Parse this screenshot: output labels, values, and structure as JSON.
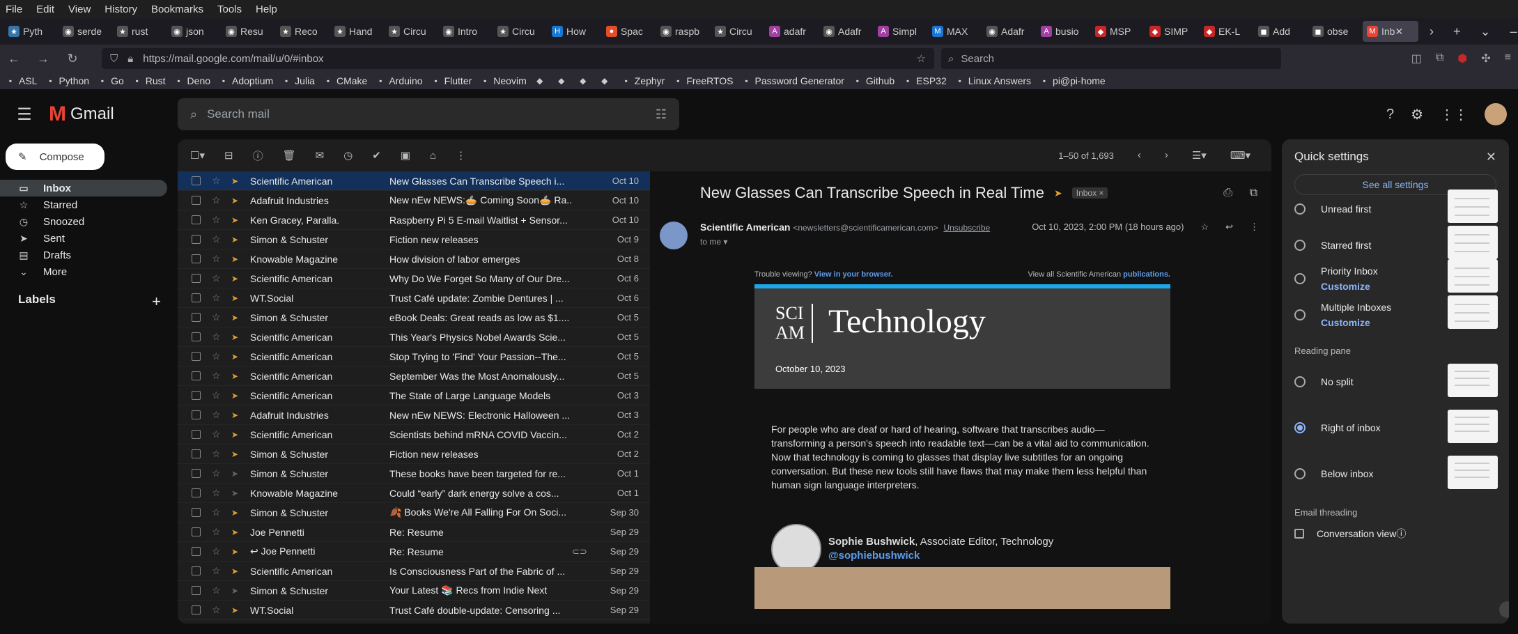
{
  "menubar": [
    "File",
    "Edit",
    "View",
    "History",
    "Bookmarks",
    "Tools",
    "Help"
  ],
  "tabs": [
    {
      "label": "Pyth",
      "color": "#3776ab",
      "glyph": "★"
    },
    {
      "label": "serde",
      "color": "#555",
      "glyph": "◉"
    },
    {
      "label": "rust",
      "color": "#555",
      "glyph": "★"
    },
    {
      "label": "json",
      "color": "#555",
      "glyph": "◉"
    },
    {
      "label": "Resu",
      "color": "#555",
      "glyph": "◉"
    },
    {
      "label": "Reco",
      "color": "#555",
      "glyph": "★"
    },
    {
      "label": "Hand",
      "color": "#555",
      "glyph": "★"
    },
    {
      "label": "Circu",
      "color": "#555",
      "glyph": "★"
    },
    {
      "label": "Intro",
      "color": "#555",
      "glyph": "◉"
    },
    {
      "label": "Circu",
      "color": "#555",
      "glyph": "★"
    },
    {
      "label": "How",
      "color": "#1976d2",
      "glyph": "H"
    },
    {
      "label": "Spac",
      "color": "#e44d26",
      "glyph": "●"
    },
    {
      "label": "raspb",
      "color": "#555",
      "glyph": "◉"
    },
    {
      "label": "Circu",
      "color": "#555",
      "glyph": "★"
    },
    {
      "label": "adafr",
      "color": "#a040a0",
      "glyph": "A"
    },
    {
      "label": "Adafr",
      "color": "#555",
      "glyph": "◉"
    },
    {
      "label": "Simpl",
      "color": "#a040a0",
      "glyph": "A"
    },
    {
      "label": "MAX",
      "color": "#1976d2",
      "glyph": "M"
    },
    {
      "label": "Adafr",
      "color": "#555",
      "glyph": "◉"
    },
    {
      "label": "busio",
      "color": "#a040a0",
      "glyph": "A"
    },
    {
      "label": "MSP",
      "color": "#c62828",
      "glyph": "◆"
    },
    {
      "label": "SIMP",
      "color": "#c62828",
      "glyph": "◆"
    },
    {
      "label": "EK-L",
      "color": "#c62828",
      "glyph": "◆"
    },
    {
      "label": "Add",
      "color": "#555",
      "glyph": "◼"
    },
    {
      "label": "obse",
      "color": "#555",
      "glyph": "◼"
    },
    {
      "label": "Inb",
      "color": "#ea4335",
      "glyph": "M"
    }
  ],
  "url": "https://mail.google.com/mail/u/0/#inbox",
  "browser_search_placeholder": "Search",
  "bookmarks": [
    "ASL",
    "Python",
    "Go",
    "Rust",
    "Deno",
    "Adoptium",
    "Julia",
    "CMake",
    "Arduino",
    "Flutter",
    "Neovim",
    "",
    "",
    "",
    "",
    "Zephyr",
    "FreeRTOS",
    "Password Generator",
    "Github",
    "ESP32",
    "Linux Answers",
    "pi@pi-home"
  ],
  "gmail": {
    "logo_text": "Gmail",
    "search_placeholder": "Search mail",
    "compose_label": "Compose",
    "nav": [
      {
        "label": "Inbox",
        "icon": "inbox-icon",
        "glyph": "▭"
      },
      {
        "label": "Starred",
        "icon": "star-icon",
        "glyph": "☆"
      },
      {
        "label": "Snoozed",
        "icon": "clock-icon",
        "glyph": "◷"
      },
      {
        "label": "Sent",
        "icon": "send-icon",
        "glyph": "➤"
      },
      {
        "label": "Drafts",
        "icon": "draft-icon",
        "glyph": "▤"
      },
      {
        "label": "More",
        "icon": "chevron-down-icon",
        "glyph": "⌄"
      }
    ],
    "labels_title": "Labels",
    "count": "1–50 of 1,693",
    "emails": [
      {
        "sender": "Scientific American",
        "subject": "New Glasses Can Transcribe Speech i...",
        "date": "Oct 10",
        "imp": true
      },
      {
        "sender": "Adafruit Industries",
        "subject": "New nEw NEWS:🥧 Coming Soon🥧 Ra...",
        "date": "Oct 10",
        "imp": true
      },
      {
        "sender": "Ken Gracey, Paralla.",
        "subject": "Raspberry Pi 5 E-mail Waitlist + Sensor...",
        "date": "Oct 10",
        "imp": true
      },
      {
        "sender": "Simon & Schuster",
        "subject": "Fiction new releases",
        "date": "Oct 9",
        "imp": true
      },
      {
        "sender": "Knowable Magazine",
        "subject": "How division of labor emerges",
        "date": "Oct 8",
        "imp": true
      },
      {
        "sender": "Scientific American",
        "subject": "Why Do We Forget So Many of Our Dre...",
        "date": "Oct 6",
        "imp": true
      },
      {
        "sender": "WT.Social",
        "subject": "Trust Café update: Zombie Dentures | ...",
        "date": "Oct 6",
        "imp": true
      },
      {
        "sender": "Simon & Schuster",
        "subject": "eBook Deals: Great reads as low as $1....",
        "date": "Oct 5",
        "imp": true
      },
      {
        "sender": "Scientific American",
        "subject": "This Year's Physics Nobel Awards Scie...",
        "date": "Oct 5",
        "imp": true
      },
      {
        "sender": "Scientific American",
        "subject": "Stop Trying to 'Find' Your Passion--The...",
        "date": "Oct 5",
        "imp": true
      },
      {
        "sender": "Scientific American",
        "subject": "September Was the Most Anomalously...",
        "date": "Oct 5",
        "imp": true
      },
      {
        "sender": "Scientific American",
        "subject": "The State of Large Language Models",
        "date": "Oct 3",
        "imp": true
      },
      {
        "sender": "Adafruit Industries",
        "subject": "New nEw NEWS: Electronic Halloween ...",
        "date": "Oct 3",
        "imp": true
      },
      {
        "sender": "Scientific American",
        "subject": "Scientists behind mRNA COVID Vaccin...",
        "date": "Oct 2",
        "imp": true
      },
      {
        "sender": "Simon & Schuster",
        "subject": "Fiction new releases",
        "date": "Oct 2",
        "imp": true
      },
      {
        "sender": "Simon & Schuster",
        "subject": "These books have been targeted for re...",
        "date": "Oct 1",
        "imp": false
      },
      {
        "sender": "Knowable Magazine",
        "subject": "Could “early” dark energy solve a cos...",
        "date": "Oct 1",
        "imp": false
      },
      {
        "sender": "Simon & Schuster",
        "subject": "🍂 Books We're All Falling For On Soci...",
        "date": "Sep 30",
        "imp": true
      },
      {
        "sender": "Joe Pennetti",
        "subject": "Re: Resume",
        "date": "Sep 29",
        "imp": true
      },
      {
        "sender": "↩  Joe Pennetti",
        "subject": "Re: Resume",
        "date": "Sep 29",
        "imp": true,
        "att": true
      },
      {
        "sender": "Scientific American",
        "subject": "Is Consciousness Part of the Fabric of ...",
        "date": "Sep 29",
        "imp": true
      },
      {
        "sender": "Simon & Schuster",
        "subject": "Your Latest 📚 Recs from Indie Next",
        "date": "Sep 29",
        "imp": false
      },
      {
        "sender": "WT.Social",
        "subject": "Trust Café double-update: Censoring ...",
        "date": "Sep 29",
        "imp": true
      }
    ],
    "reader": {
      "title": "New Glasses Can Transcribe Speech in Real Time",
      "chip": "Inbox ×",
      "sender_name": "Scientific American",
      "sender_email": "<newsletters@scientificamerican.com>",
      "unsubscribe": "Unsubscribe",
      "to": "to me ▾",
      "time": "Oct 10, 2023, 2:00 PM (18 hours ago)",
      "trouble": "Trouble viewing?",
      "trouble_link": "View in your browser.",
      "view_all": "View all Scientific American",
      "view_all_link": "publications.",
      "banner_sci": "SCI",
      "banner_am": "AM",
      "banner_title": "Technology",
      "banner_date": "October 10, 2023",
      "body": "For people who are deaf or hard of hearing, software that transcribes audio—transforming a person's speech into readable text—can be a vital aid to communication. Now that technology is coming to glasses that display live subtitles for an ongoing conversation. But these new tools still have flaws that may make them less helpful than human sign language interpreters.",
      "author_name": "Sophie Bushwick",
      "author_role": ", Associate Editor, Technology",
      "author_handle": "@sophiebushwick"
    }
  },
  "quick_settings": {
    "title": "Quick settings",
    "see_all": "See all settings",
    "inbox_options": [
      {
        "label": "Unread first",
        "link": ""
      },
      {
        "label": "Starred first",
        "link": ""
      },
      {
        "label": "Priority Inbox",
        "link": "Customize"
      },
      {
        "label": "Multiple Inboxes",
        "link": "Customize"
      }
    ],
    "reading_pane_title": "Reading pane",
    "reading_pane": [
      {
        "label": "No split",
        "selected": false
      },
      {
        "label": "Right of inbox",
        "selected": true
      },
      {
        "label": "Below inbox",
        "selected": false
      }
    ],
    "threading_title": "Email threading",
    "conversation_view": "Conversation view"
  }
}
